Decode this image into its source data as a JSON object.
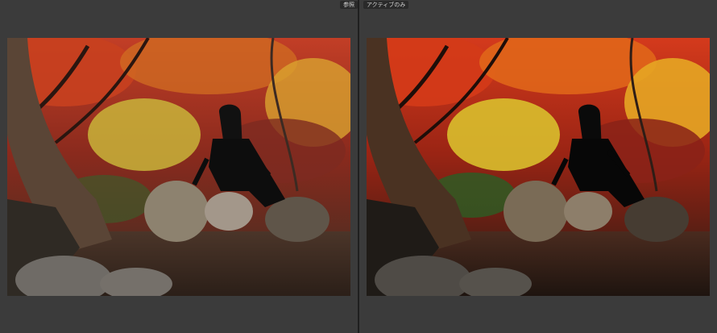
{
  "toolbar": {
    "reference_label": "参照",
    "active_label": "アクティブのみ"
  },
  "panes": {
    "reference_icon": "photo-before",
    "active_icon": "photo-after"
  },
  "colors": {
    "background": "#3b3b3b",
    "divider": "#1f1f1f",
    "label_bg": "#2a2a2a",
    "label_text": "#d2d2d2"
  }
}
